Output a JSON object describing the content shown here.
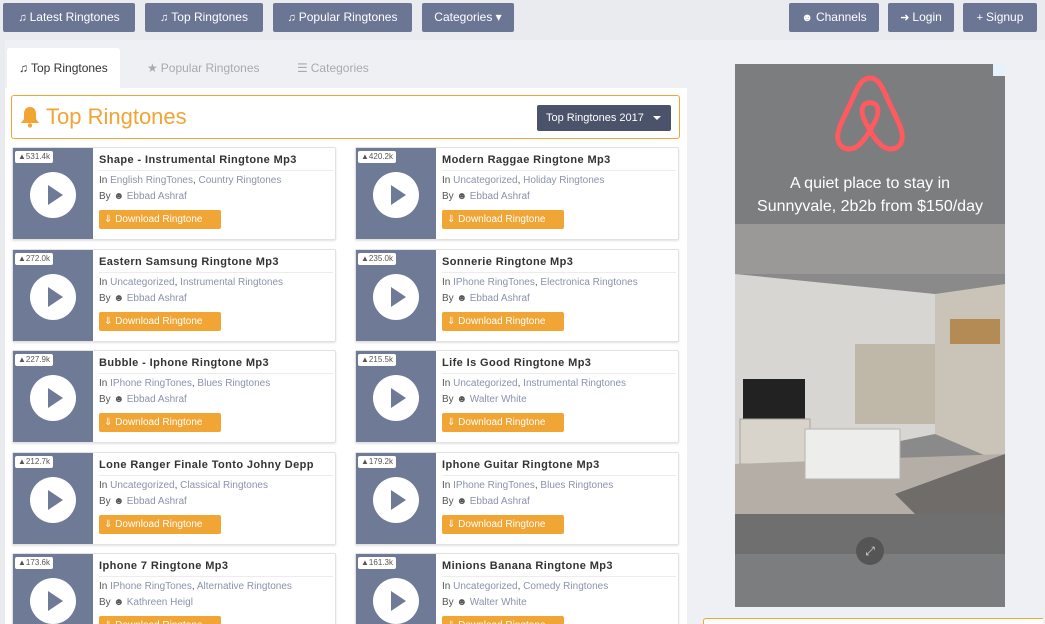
{
  "topnav": {
    "latest": "Latest Ringtones",
    "top": "Top Ringtones",
    "popular": "Popular Ringtones",
    "categories": "Categories",
    "channels": "Channels",
    "login": "Login",
    "signup": "Signup"
  },
  "tabs": {
    "top": "Top Ringtones",
    "popular": "Popular Ringtones",
    "categories": "Categories"
  },
  "section": {
    "title": "Top Ringtones",
    "dropdown": "Top Ringtones 2017"
  },
  "labels": {
    "in": "In",
    "by": "By",
    "download": "Download Ringtone"
  },
  "ringtones": [
    {
      "count": "531.4k",
      "title": "Shape - Instrumental Ringtone Mp3",
      "cat1": "English RingTones",
      "cat2": "Country Ringtones",
      "author": "Ebbad Ashraf"
    },
    {
      "count": "420.2k",
      "title": "Modern Raggae Ringtone Mp3",
      "cat1": "Uncategorized",
      "cat2": "Holiday Ringtones",
      "author": "Ebbad Ashraf"
    },
    {
      "count": "272.0k",
      "title": "Eastern Samsung Ringtone Mp3",
      "cat1": "Uncategorized",
      "cat2": "Instrumental Ringtones",
      "author": "Ebbad Ashraf"
    },
    {
      "count": "235.0k",
      "title": "Sonnerie Ringtone Mp3",
      "cat1": "IPhone RingTones",
      "cat2": "Electronica Ringtones",
      "author": "Ebbad Ashraf"
    },
    {
      "count": "227.9k",
      "title": "Bubble - Iphone Ringtone Mp3",
      "cat1": "IPhone RingTones",
      "cat2": "Blues Ringtones",
      "author": "Ebbad Ashraf"
    },
    {
      "count": "215.5k",
      "title": "Life Is Good Ringtone Mp3",
      "cat1": "Uncategorized",
      "cat2": "Instrumental Ringtones",
      "author": "Walter White"
    },
    {
      "count": "212.7k",
      "title": "Lone Ranger Finale Tonto Johny Depp",
      "cat1": "Uncategorized",
      "cat2": "Classical Ringtones",
      "author": "Ebbad Ashraf"
    },
    {
      "count": "179.2k",
      "title": "Iphone Guitar Ringtone Mp3",
      "cat1": "IPhone RingTones",
      "cat2": "Blues Ringtones",
      "author": "Ebbad Ashraf"
    },
    {
      "count": "173.6k",
      "title": "Iphone 7 Ringtone Mp3",
      "cat1": "IPhone RingTones",
      "cat2": "Alternative Ringtones",
      "author": "Kathreen Heigl"
    },
    {
      "count": "161.3k",
      "title": "Minions Banana Ringtone Mp3",
      "cat1": "Uncategorized",
      "cat2": "Comedy Ringtones",
      "author": "Walter White"
    }
  ],
  "ad": {
    "text_line1": "A quiet place to stay in",
    "text_line2": "Sunnyvale, 2b2b from $150/day"
  },
  "colors": {
    "accent": "#f0a535",
    "nav": "#6b7694",
    "brand_ad": "#ff5a5f"
  }
}
